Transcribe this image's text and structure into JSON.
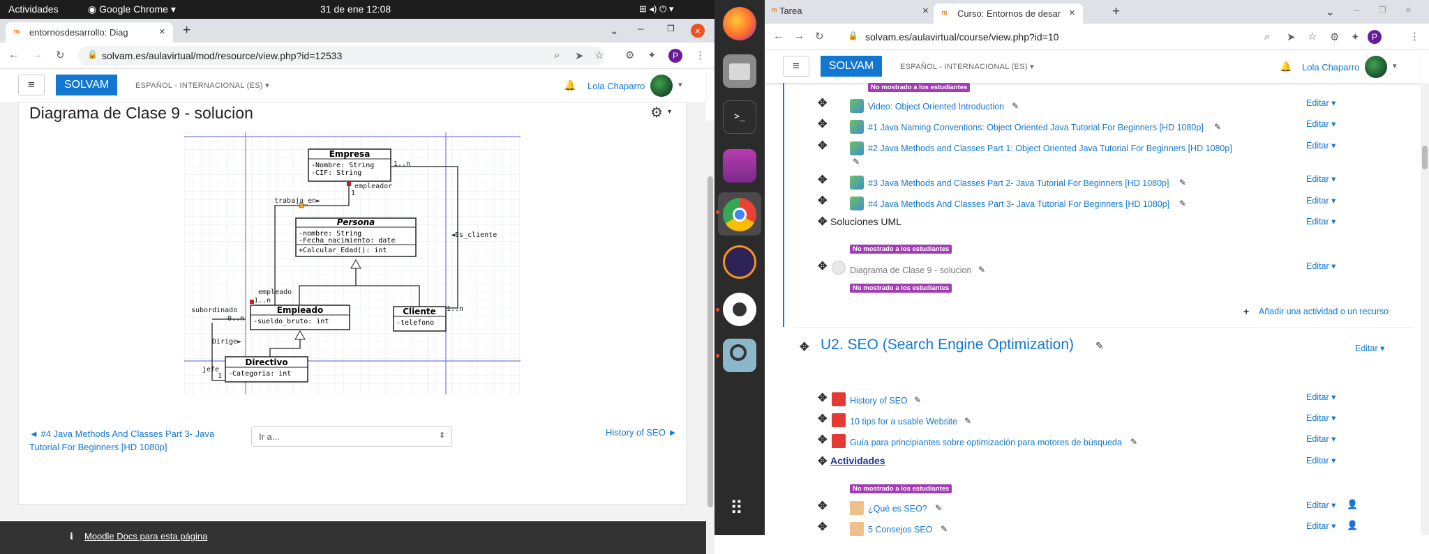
{
  "system": {
    "activities": "Actividades",
    "app": "Google Chrome",
    "datetime": "31 de ene  12:08"
  },
  "left": {
    "tab_title": "entornosdesarrollo: Diag",
    "url": "solvam.es/aulavirtual/mod/resource/view.php?id=12533",
    "brand": "SOLVAM",
    "lang": "ESPAÑOL - INTERNACIONAL (ES)",
    "user": "Lola Chaparro",
    "page_title": "Diagrama de Clase 9 - solucion",
    "prev_link": "◄ #4 Java Methods And Classes Part 3- Java Tutorial For Beginners [HD 1080p]",
    "jump_placeholder": "Ir a...",
    "next_link": "History of SEO ►",
    "footer_link": "Moodle Docs para esta página",
    "profile_initial": "P"
  },
  "uml": {
    "empresa": {
      "name": "Empresa",
      "attrs": [
        "-Nombre: String",
        "-CIF: String"
      ]
    },
    "persona": {
      "name": "Persona",
      "attrs": [
        "-nombre: String",
        "-Fecha_nacimiento: date"
      ],
      "ops": [
        "+Calcular_Edad(): int"
      ]
    },
    "empleado": {
      "name": "Empleado",
      "attrs": [
        "-sueldo_bruto: int"
      ]
    },
    "cliente": {
      "name": "Cliente",
      "attrs": [
        "-telefono"
      ]
    },
    "directivo": {
      "name": "Directivo",
      "attrs": [
        "-Categoria: int"
      ]
    },
    "labels": {
      "trabaja": "trabaja_en►",
      "empleador": "empleador",
      "one": "1",
      "one_n": "1..n",
      "es_cliente": "◄Es_cliente",
      "empleado": "empleado",
      "one_n2": "1..n",
      "subordinado": "subordinado",
      "zero_n": "0..n",
      "dirige": "Dirige►",
      "jefe": "jefe",
      "one2": "1",
      "one_n3": "1..n"
    }
  },
  "right": {
    "tab1": "Tarea",
    "tab2": "Curso: Entornos de desar",
    "url": "solvam.es/aulavirtual/course/view.php?id=10",
    "brand": "SOLVAM",
    "lang": "ESPAÑOL - INTERNACIONAL (ES)",
    "user": "Lola Chaparro",
    "profile_initial": "P",
    "hidden_badge": "No mostrado a los estudiantes",
    "edit": "Editar",
    "items": [
      "Video: Object Oriented Introduction",
      "#1 Java Naming Conventions: Object Oriented Java Tutorial For Beginners [HD 1080p]",
      "#2 Java Methods and Classes Part 1: Object Oriented Java Tutorial For Beginners [HD 1080p]",
      "#3 Java Methods and Classes Part 2- Java Tutorial For Beginners [HD 1080p]",
      "#4 Java Methods And Classes Part 3- Java Tutorial For Beginners [HD 1080p]"
    ],
    "soluciones": "Soluciones UML",
    "diagrama": "Diagrama de Clase 9 - solucion",
    "add_activity": "Añadir una actividad o un recurso",
    "section2_title": "U2. SEO (Search Engine Optimization)",
    "section2_items": [
      "History of SEO",
      "10 tips for a usable Website",
      "Guía para principiantes sobre optimización para motores de búsqueda"
    ],
    "actividades": "Actividades",
    "quizzes": [
      "¿Qué es SEO?",
      "5 Consejos SEO"
    ]
  }
}
